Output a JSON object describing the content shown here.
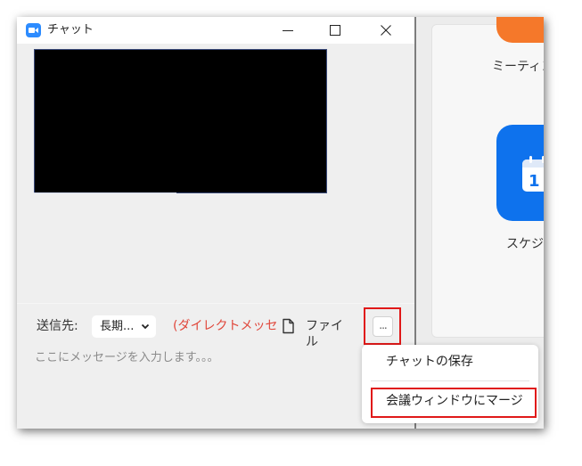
{
  "window": {
    "title": "チャット",
    "icon": "zoom-camera-icon",
    "minimize_icon": "minimize-icon",
    "maximize_icon": "maximize-icon",
    "close_icon": "close-icon"
  },
  "compose": {
    "to_label": "送信先:",
    "recipient_value": "長期...",
    "direct_message_note": "(ダイレクトメッセージ",
    "file_label": "ファイル",
    "more_label": "...",
    "message_placeholder": "ここにメッセージを入力します。。。"
  },
  "context_menu": {
    "items": [
      {
        "label": "チャットの保存"
      },
      {
        "label": "会議ウィンドウにマージ"
      }
    ]
  },
  "main_panel": {
    "meeting_label": "ミーティン",
    "schedule_label": "スケジ",
    "calendar_day": "1"
  },
  "colors": {
    "highlight_red": "#e01919",
    "direct_message_red": "#e0473b",
    "zoom_blue": "#0e72ed",
    "meeting_orange": "#f5782a"
  }
}
